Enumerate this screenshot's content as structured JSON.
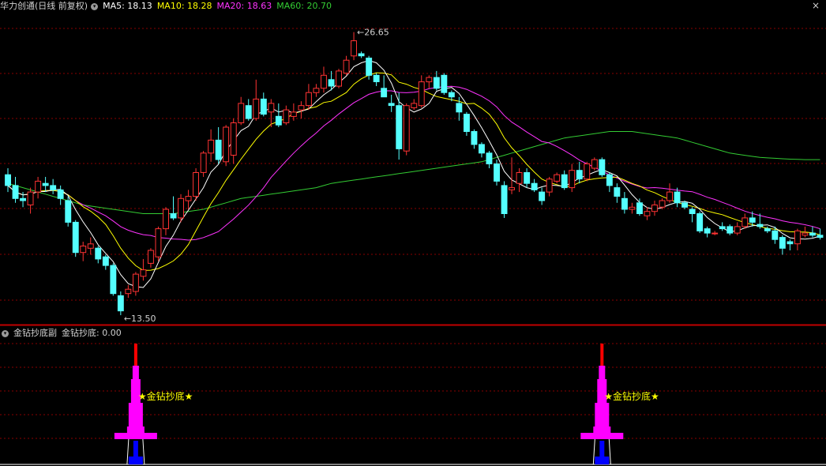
{
  "main_panel": {
    "title": "华力创通(日线 前复权)",
    "ma_legend": [
      {
        "label": "MA5: 18.13",
        "color": "#ffffff"
      },
      {
        "label": "MA10: 18.28",
        "color": "#ffff00"
      },
      {
        "label": "MA20: 18.63",
        "color": "#ff33ff"
      },
      {
        "label": "MA60: 20.70",
        "color": "#33cc33"
      }
    ],
    "high_label": "26.65",
    "low_label": "13.50",
    "close_symbol": "×",
    "dropdown_icon": "chevron-down-icon"
  },
  "sub_panel": {
    "title": "金钻抄底副",
    "indicator": "金钻抄底: 0.00",
    "signal_text": "★金钻抄底★"
  },
  "colors": {
    "up": "#ff3333",
    "down": "#54ffff",
    "ma5": "#ffffff",
    "ma10": "#ffff00",
    "ma20": "#ff33ff",
    "ma60": "#33cc33",
    "grid": "#8a0000",
    "separator": "#c00000",
    "signal_magenta": "#ff00ff",
    "signal_red": "#ff0000",
    "signal_blue": "#0000ff",
    "signal_text": "#ffff00"
  },
  "chart_data": {
    "type": "candlestick",
    "ylim": [
      13.1,
      27.5
    ],
    "candles": [
      [
        20.0,
        20.3,
        19.2,
        19.5
      ],
      [
        19.5,
        19.9,
        18.7,
        18.9
      ],
      [
        18.9,
        19.2,
        18.5,
        18.8
      ],
      [
        18.6,
        19.4,
        18.2,
        19.2
      ],
      [
        19.2,
        19.9,
        18.9,
        19.7
      ],
      [
        19.6,
        19.9,
        19.2,
        19.5
      ],
      [
        19.5,
        19.8,
        19.1,
        19.3
      ],
      [
        19.3,
        19.5,
        18.6,
        18.9
      ],
      [
        18.8,
        19.0,
        17.6,
        17.8
      ],
      [
        17.8,
        17.9,
        16.2,
        16.4
      ],
      [
        16.4,
        16.9,
        16.0,
        16.7
      ],
      [
        16.6,
        17.1,
        16.3,
        16.8
      ],
      [
        16.6,
        16.7,
        15.9,
        16.1
      ],
      [
        16.2,
        16.3,
        15.6,
        15.8
      ],
      [
        15.8,
        15.9,
        14.4,
        14.5
      ],
      [
        14.4,
        14.6,
        13.5,
        13.7
      ],
      [
        14.5,
        14.9,
        14.3,
        14.7
      ],
      [
        14.6,
        15.5,
        14.4,
        15.4
      ],
      [
        15.3,
        16.1,
        15.1,
        15.6
      ],
      [
        15.9,
        16.6,
        15.7,
        16.5
      ],
      [
        16.2,
        17.6,
        16.0,
        17.5
      ],
      [
        17.5,
        18.5,
        17.2,
        18.4
      ],
      [
        18.2,
        19.0,
        17.9,
        18.0
      ],
      [
        18.0,
        19.1,
        17.8,
        18.9
      ],
      [
        18.8,
        19.3,
        18.4,
        19.0
      ],
      [
        19.0,
        20.3,
        18.8,
        20.1
      ],
      [
        20.1,
        21.1,
        19.9,
        21.0
      ],
      [
        21.0,
        22.1,
        20.6,
        21.6
      ],
      [
        21.6,
        22.2,
        20.5,
        20.7
      ],
      [
        20.6,
        22.3,
        20.4,
        22.2
      ],
      [
        20.9,
        22.6,
        20.5,
        22.4
      ],
      [
        22.4,
        23.6,
        22.3,
        23.3
      ],
      [
        23.2,
        23.5,
        22.5,
        22.6
      ],
      [
        22.6,
        24.4,
        22.5,
        23.5
      ],
      [
        23.5,
        23.8,
        22.7,
        22.8
      ],
      [
        22.9,
        23.5,
        22.2,
        23.3
      ],
      [
        22.7,
        23.3,
        22.2,
        22.3
      ],
      [
        22.4,
        23.2,
        22.3,
        23.0
      ],
      [
        22.7,
        23.3,
        22.5,
        22.9
      ],
      [
        23.0,
        23.4,
        22.6,
        23.2
      ],
      [
        23.2,
        24.2,
        23.0,
        23.8
      ],
      [
        23.8,
        24.2,
        23.6,
        24.0
      ],
      [
        24.0,
        25.0,
        23.8,
        24.6
      ],
      [
        24.4,
        24.8,
        23.9,
        24.1
      ],
      [
        24.1,
        24.9,
        24.0,
        24.8
      ],
      [
        24.7,
        25.5,
        24.6,
        25.3
      ],
      [
        25.5,
        26.6,
        25.3,
        26.2
      ],
      [
        25.6,
        25.7,
        25.4,
        25.5
      ],
      [
        25.4,
        25.5,
        24.4,
        24.6
      ],
      [
        24.6,
        24.7,
        24.1,
        24.3
      ],
      [
        24.0,
        24.6,
        23.6,
        23.6
      ],
      [
        23.3,
        23.7,
        22.9,
        23.2
      ],
      [
        23.2,
        23.8,
        20.7,
        21.2
      ],
      [
        21.1,
        23.3,
        20.9,
        23.2
      ],
      [
        23.1,
        23.5,
        23.0,
        23.3
      ],
      [
        23.2,
        24.6,
        23.1,
        24.3
      ],
      [
        24.3,
        24.6,
        24.0,
        24.5
      ],
      [
        24.5,
        24.8,
        23.9,
        24.0
      ],
      [
        24.6,
        24.7,
        23.7,
        23.8
      ],
      [
        23.8,
        23.9,
        23.4,
        23.6
      ],
      [
        23.3,
        23.6,
        22.5,
        22.9
      ],
      [
        22.8,
        22.9,
        21.8,
        22.0
      ],
      [
        22.0,
        22.1,
        21.2,
        21.4
      ],
      [
        21.4,
        21.5,
        20.8,
        21.0
      ],
      [
        21.0,
        21.1,
        20.3,
        20.5
      ],
      [
        20.5,
        20.7,
        19.5,
        19.7
      ],
      [
        19.5,
        19.7,
        18.0,
        18.2
      ],
      [
        19.3,
        20.8,
        19.1,
        19.4
      ],
      [
        19.6,
        20.3,
        19.2,
        20.1
      ],
      [
        20.1,
        20.3,
        19.4,
        19.6
      ],
      [
        19.6,
        19.8,
        19.2,
        19.3
      ],
      [
        19.2,
        19.4,
        18.6,
        18.8
      ],
      [
        19.2,
        19.9,
        19.0,
        19.8
      ],
      [
        19.7,
        20.1,
        19.6,
        20.0
      ],
      [
        20.0,
        20.2,
        19.3,
        19.4
      ],
      [
        19.4,
        20.5,
        19.2,
        20.2
      ],
      [
        20.2,
        20.6,
        19.6,
        19.8
      ],
      [
        19.8,
        20.6,
        19.7,
        20.5
      ],
      [
        20.3,
        20.8,
        20.2,
        20.7
      ],
      [
        20.7,
        20.8,
        19.9,
        20.0
      ],
      [
        20.0,
        20.1,
        19.2,
        19.5
      ],
      [
        19.4,
        19.6,
        18.7,
        19.0
      ],
      [
        18.9,
        19.2,
        18.2,
        18.4
      ],
      [
        18.4,
        18.7,
        18.2,
        18.5
      ],
      [
        18.7,
        18.9,
        18.1,
        18.2
      ],
      [
        18.1,
        18.5,
        17.9,
        18.3
      ],
      [
        18.3,
        18.8,
        18.1,
        18.6
      ],
      [
        18.5,
        18.9,
        18.4,
        18.8
      ],
      [
        18.8,
        19.6,
        18.7,
        19.2
      ],
      [
        19.2,
        19.4,
        18.5,
        18.7
      ],
      [
        18.7,
        18.8,
        18.4,
        18.5
      ],
      [
        18.4,
        18.5,
        17.8,
        18.2
      ],
      [
        18.2,
        18.3,
        17.3,
        17.4
      ],
      [
        17.5,
        17.6,
        17.1,
        17.3
      ],
      [
        17.3,
        17.4,
        17.2,
        17.3
      ],
      [
        17.6,
        17.8,
        17.4,
        17.5
      ],
      [
        17.6,
        17.7,
        17.2,
        17.3
      ],
      [
        17.3,
        17.8,
        17.2,
        17.6
      ],
      [
        17.6,
        18.2,
        17.5,
        18.0
      ],
      [
        18.0,
        18.3,
        17.6,
        17.8
      ],
      [
        17.7,
        18.2,
        17.5,
        17.6
      ],
      [
        17.5,
        17.6,
        17.3,
        17.4
      ],
      [
        17.4,
        17.6,
        16.8,
        17.0
      ],
      [
        17.1,
        17.2,
        16.3,
        16.6
      ],
      [
        16.9,
        17.0,
        16.5,
        16.8
      ],
      [
        16.8,
        17.5,
        16.5,
        17.4
      ],
      [
        17.2,
        17.6,
        17.1,
        17.3
      ],
      [
        17.3,
        17.6,
        17.1,
        17.2
      ],
      [
        17.2,
        17.5,
        17.0,
        17.1
      ]
    ],
    "ma60": [
      19.6,
      19.5,
      19.4,
      19.3,
      19.2,
      19.1,
      19.0,
      18.9,
      18.8,
      18.7,
      18.6,
      18.55,
      18.5,
      18.45,
      18.4,
      18.35,
      18.3,
      18.25,
      18.2,
      18.2,
      18.2,
      18.2,
      18.2,
      18.25,
      18.3,
      18.35,
      18.4,
      18.5,
      18.6,
      18.7,
      18.8,
      18.9,
      18.95,
      19.0,
      19.05,
      19.1,
      19.15,
      19.2,
      19.25,
      19.3,
      19.35,
      19.4,
      19.5,
      19.6,
      19.65,
      19.7,
      19.75,
      19.8,
      19.85,
      19.9,
      19.95,
      20.0,
      20.05,
      20.1,
      20.15,
      20.2,
      20.25,
      20.3,
      20.35,
      20.4,
      20.45,
      20.5,
      20.55,
      20.6,
      20.7,
      20.8,
      20.9,
      21.0,
      21.1,
      21.2,
      21.3,
      21.4,
      21.5,
      21.6,
      21.7,
      21.75,
      21.8,
      21.85,
      21.9,
      21.95,
      22.0,
      22.0,
      22.0,
      22.0,
      21.95,
      21.9,
      21.85,
      21.8,
      21.75,
      21.7,
      21.6,
      21.5,
      21.4,
      21.3,
      21.2,
      21.1,
      21.0,
      20.95,
      20.9,
      20.85,
      20.8,
      20.78,
      20.76,
      20.74,
      20.72,
      20.71,
      20.7,
      20.7,
      20.7
    ]
  },
  "signal_chart": {
    "type": "signal_bars",
    "signals": [
      {
        "candle_index": 17,
        "label": "★金钻抄底★"
      },
      {
        "candle_index": 79,
        "label": "★金钻抄底★"
      }
    ]
  }
}
